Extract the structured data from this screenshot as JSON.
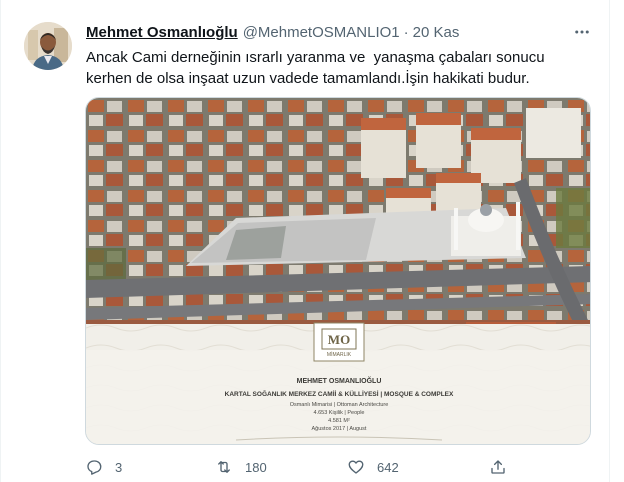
{
  "tweet": {
    "author_name": "Mehmet Osmanlıoğlu",
    "author_handle": "@MehmetOSMANLIO1",
    "separator": "·",
    "date": "20 Kas",
    "text": "Ancak Cami derneğinin ısrarlı yaranma ve  yanaşma çabaları sonucu kerhen de olsa inşaat uzun vadede tamamlandı.İşin hakikati budur."
  },
  "media": {
    "logo_text": "MO",
    "logo_subtitle": "MİMARLIK",
    "caption_name": "MEHMET OSMANLIOĞLU",
    "caption_title": "KARTAL SOĞANLIK MERKEZ CAMİİ & KÜLLİYESİ | MOSQUE & COMPLEX",
    "caption_lines": [
      "Osmanlı Mimarisi | Ottoman Architecture",
      "4.653 Kişilik | People",
      "4.581 M²",
      "Ağustos 2017 | August"
    ]
  },
  "actions": {
    "reply_count": "3",
    "retweet_count": "180",
    "like_count": "642"
  },
  "icons": {
    "more": "more-horizontal-icon",
    "reply": "reply-icon",
    "retweet": "retweet-icon",
    "like": "heart-icon",
    "share": "share-icon"
  },
  "colors": {
    "text_primary": "#0f1419",
    "text_secondary": "#536471",
    "border": "#cfd9de"
  }
}
